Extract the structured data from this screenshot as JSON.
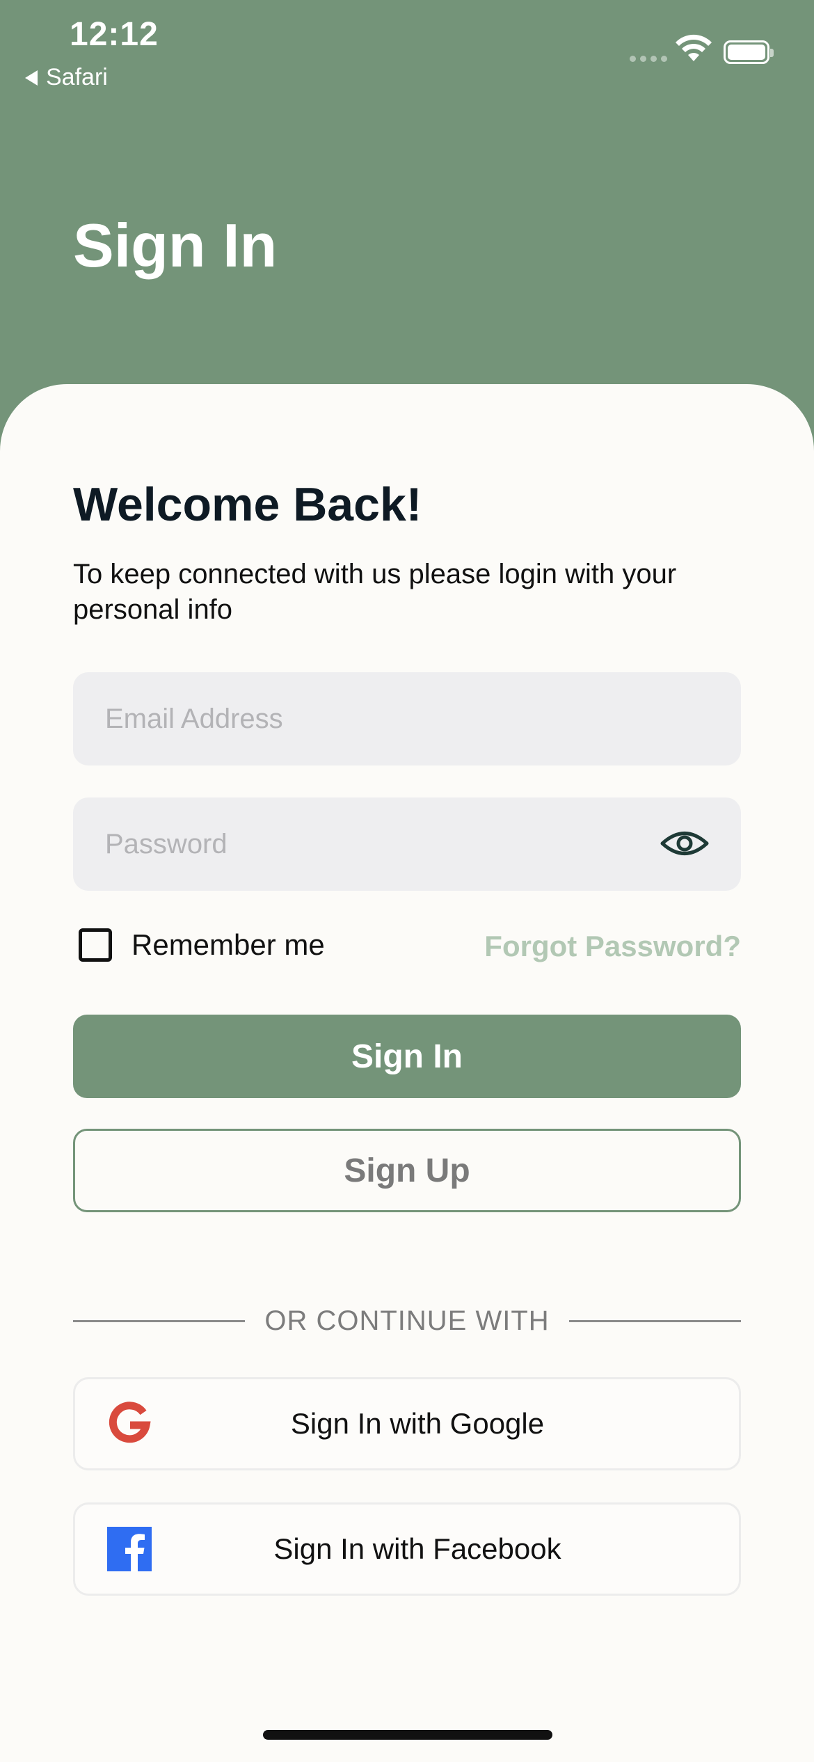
{
  "status_bar": {
    "time": "12:12",
    "back_app": "Safari",
    "icons": [
      "signal-dots-icon",
      "wifi-icon",
      "battery-icon"
    ]
  },
  "header": {
    "title": "Sign In"
  },
  "card": {
    "welcome": "Welcome Back!",
    "subtitle": "To keep connected with us please login with your personal info"
  },
  "form": {
    "email_placeholder": "Email Address",
    "email_value": "",
    "password_placeholder": "Password",
    "password_value": "",
    "remember_label": "Remember me",
    "remember_checked": false,
    "forgot_label": "Forgot Password?"
  },
  "actions": {
    "sign_in_label": "Sign In",
    "sign_up_label": "Sign Up"
  },
  "divider": {
    "text": "OR CONTINUE WITH"
  },
  "social": [
    {
      "label": "Sign In with Google",
      "icon": "google-icon"
    },
    {
      "label": "Sign In with Facebook",
      "icon": "facebook-icon"
    }
  ],
  "colors": {
    "brand": "#749479",
    "brand_light": "#b2c8b4",
    "card_bg": "#fcfbf8",
    "input_bg": "#eeeef0",
    "text_dark": "#0e1a24",
    "google_red": "#d94a3d",
    "facebook_blue": "#2f6df2"
  }
}
